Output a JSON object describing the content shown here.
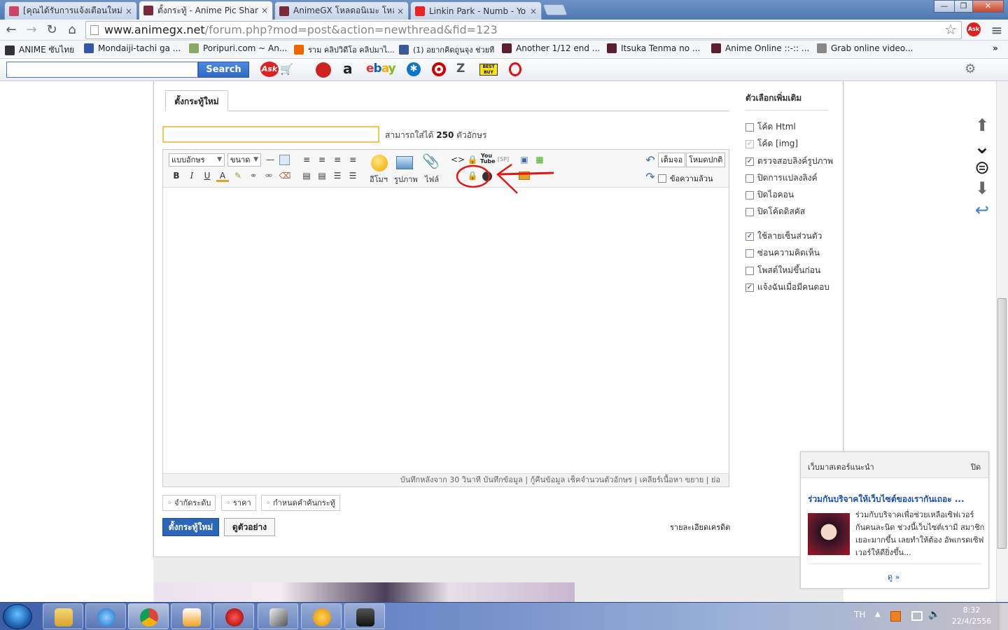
{
  "tabs": [
    {
      "label": "[คุณได้รับการแจ้งเตือนใหม่]A",
      "close": "×",
      "fav": "#c46"
    },
    {
      "label": "ตั้งกระทู้ - Anime Pic Shar",
      "close": "×",
      "fav": "#7a2a3a"
    },
    {
      "label": "AnimeGX โหลดอนิเมะ โหล",
      "close": "×",
      "fav": "#7a2a3a"
    },
    {
      "label": "Linkin Park - Numb - Yo",
      "close": "×",
      "fav": "#e22"
    }
  ],
  "window": {
    "minimize": "—",
    "maximize": "❐",
    "close": "✕"
  },
  "toolbar": {
    "back": "←",
    "forward": "→",
    "reload": "↻",
    "home": "⌂",
    "url_domain": "www.animegx.net",
    "url_path": "/forum.php?mod=post&action=newthread&fid=123",
    "star": "☆",
    "menu": "≡"
  },
  "bookmarks": [
    {
      "label": "ANIME ซับไทย",
      "fav": "#333"
    },
    {
      "label": "Mondaiji-tachi ga ...",
      "fav": "#35a"
    },
    {
      "label": "Poripuri.com ~ An...",
      "fav": "#8a6"
    },
    {
      "label": "ราม คลิปวิดีโอ คลิปมาไ...",
      "fav": "#e60"
    },
    {
      "label": "(1) อยากคิดถูนจุง ช่วยที",
      "fav": "#3b5998"
    },
    {
      "label": "Another 1/12 end ...",
      "fav": "#5a2030"
    },
    {
      "label": "Itsuka Tenma no ...",
      "fav": "#5a2030"
    },
    {
      "label": "Anime Online ::-:: ...",
      "fav": "#5a2030"
    },
    {
      "label": "Grab online video...",
      "fav": "#888"
    }
  ],
  "bookmarks_more": "»",
  "askbar": {
    "search_placeholder": "",
    "search_button": "Search",
    "ask_logo": "Ask",
    "amazon": "a",
    "ebay": "ebay",
    "bestbuy": "BEST BUY"
  },
  "thread": {
    "tab": "ตั้งกระทู้ใหม่",
    "subject_value": "",
    "subject_hint_prefix": "สามารถใส่ได้",
    "subject_hint_count": "250",
    "subject_hint_suffix": "ตัวอักษร"
  },
  "editor": {
    "font_select": "แบบอักษร",
    "size_select": "ขนาด",
    "emoticon_label": "อีโมฯ",
    "image_label": "รูปภาพ",
    "file_label": "ไฟล์",
    "youtube": "You Tube",
    "sp_tag": "[SP]",
    "fullscreen": "เต็มจอ",
    "normal_mode": "โหมดปกติ",
    "plain_text": "ข้อความล้วน",
    "status_text": "บันทึกหลังจาก 30 วินาที บันทึกข้อมูล | กู้คืนข้อมูล    เช็คจำนวนตัวอักษร | เคลียร์เนื้อหา    ขยาย | ย่อ"
  },
  "chips": [
    "จำกัดระดับ",
    "ราคา",
    "กำหนดคำค้นกระทู้"
  ],
  "buttons": {
    "post": "ตั้งกระทู้ใหม่",
    "preview": "ดูตัวอย่าง"
  },
  "credit_link": "รายละเอียดเครดิต",
  "options": {
    "heading": "ตัวเลือกเพิ่มเติม",
    "items": [
      {
        "label": "โค้ด Html",
        "checked": false,
        "disabled": false
      },
      {
        "label": "โค้ด [img]",
        "checked": true,
        "disabled": true
      },
      {
        "label": "ตรวจสอบลิงค์รูปภาพ",
        "checked": true,
        "disabled": false
      },
      {
        "label": "ปิดการแปลงลิงค์",
        "checked": false,
        "disabled": false
      },
      {
        "label": "ปิดไอคอน",
        "checked": false,
        "disabled": false
      },
      {
        "label": "ปิดโค้ดดิสคัส",
        "checked": false,
        "disabled": false
      },
      {
        "label": "ใช้ลายเซ็นส่วนตัว",
        "checked": true,
        "disabled": false
      },
      {
        "label": "ซ่อนความคิดเห็น",
        "checked": false,
        "disabled": false
      },
      {
        "label": "โพสต์ใหม่ขึ้นก่อน",
        "checked": false,
        "disabled": false
      },
      {
        "label": "แจ้งฉันเมื่อมีคนตอบ",
        "checked": true,
        "disabled": false
      }
    ]
  },
  "popup": {
    "title": "เว็บมาสเตอร์แนะนำ",
    "close": "ปิด",
    "link": "ร่วมกันบริจาคให้เว็บไซต์ของเรากันเถอะ ...",
    "text": "ร่วมกับบริจาคเพื่อช่วยเหลือเซิฟเวอร์ กันคนละนิด ช่วงนี้เว็บไซต์เรามี สมาชิกเยอะมากขึ้น เลยทำให้ต้อง อัพเกรดเซิฟเวอร์ให้ดียิ่งขึ้น...",
    "more": "ดู »"
  },
  "taskbar": {
    "lang": "TH",
    "time": "8:32",
    "date": "22/4/2556"
  },
  "colors": {
    "accent": "#2b66b8",
    "annotation": "#e01818",
    "link": "#1c4fa8"
  }
}
